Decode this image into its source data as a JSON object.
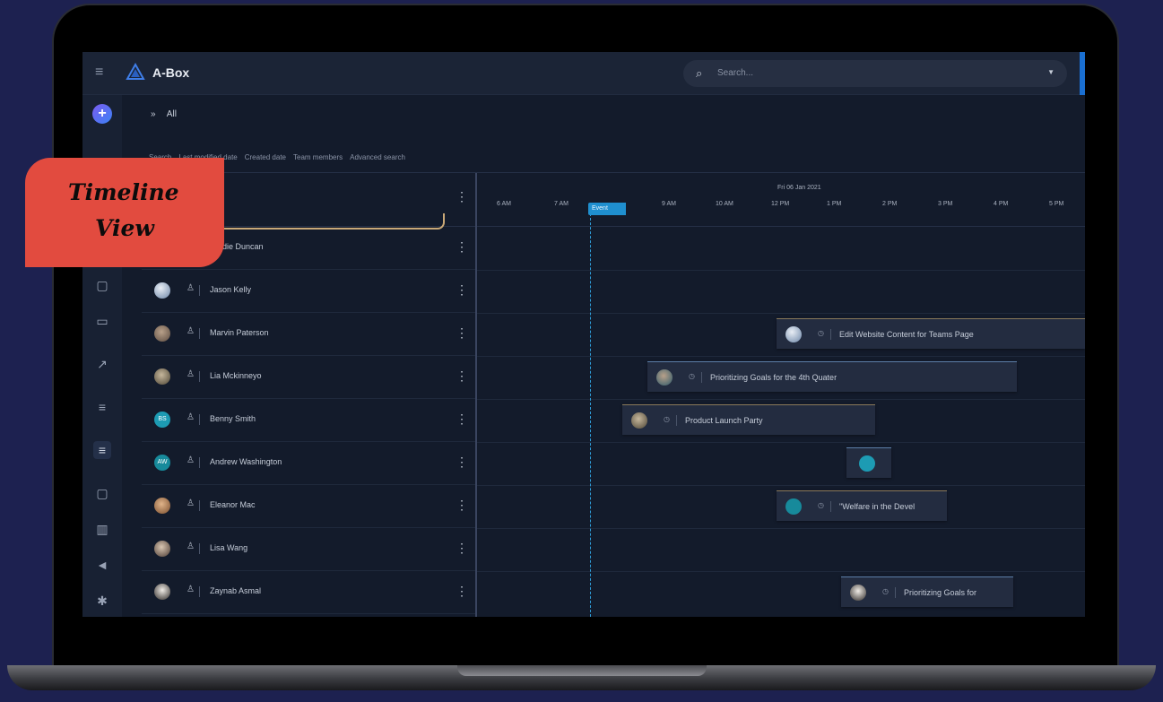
{
  "app": {
    "title": "A-Box"
  },
  "topbar": {
    "search_placeholder": "Search...",
    "search_icon": "search-icon",
    "dropdown_icon": "caret-down-icon",
    "menu_icon": "hamburger-icon"
  },
  "breadcrumb": {
    "label": "All"
  },
  "filters": [
    "Search",
    "Last modified date",
    "Created date",
    "Team members",
    "Advanced search"
  ],
  "badge": {
    "line1": "Timeline",
    "line2": "View"
  },
  "timeline": {
    "date": "Fri 06 Jan 2021",
    "hours": [
      "6 AM",
      "7 AM",
      "9 AM",
      "10 AM",
      "12 PM",
      "1 PM",
      "2 PM",
      "3 PM",
      "4 PM",
      "5 PM"
    ],
    "now_tag": "Event"
  },
  "people": [
    {
      "name": "…ddie Duncan"
    },
    {
      "name": "Jason Kelly"
    },
    {
      "name": "Marvin Paterson"
    },
    {
      "name": "Lia Mckinneyo"
    },
    {
      "name": "Benny Smith",
      "initials": "BS"
    },
    {
      "name": "Andrew Washington",
      "initials": "AW"
    },
    {
      "name": "Eleanor Mac"
    },
    {
      "name": "Lisa Wang"
    },
    {
      "name": "Zaynab Asmal"
    }
  ],
  "events": [
    {
      "title": "Edit Website Content for Teams Page"
    },
    {
      "title": "Prioritizing Goals for the 4th Quater"
    },
    {
      "title": "Product Launch Party"
    },
    {
      "title": ""
    },
    {
      "title": "\"Welfare in the Devel"
    },
    {
      "title": "Prioritizing Goals for"
    }
  ],
  "colors": {
    "accent": "#1f8fcf",
    "badge": "#e24b3f",
    "background": "#1d2150"
  }
}
